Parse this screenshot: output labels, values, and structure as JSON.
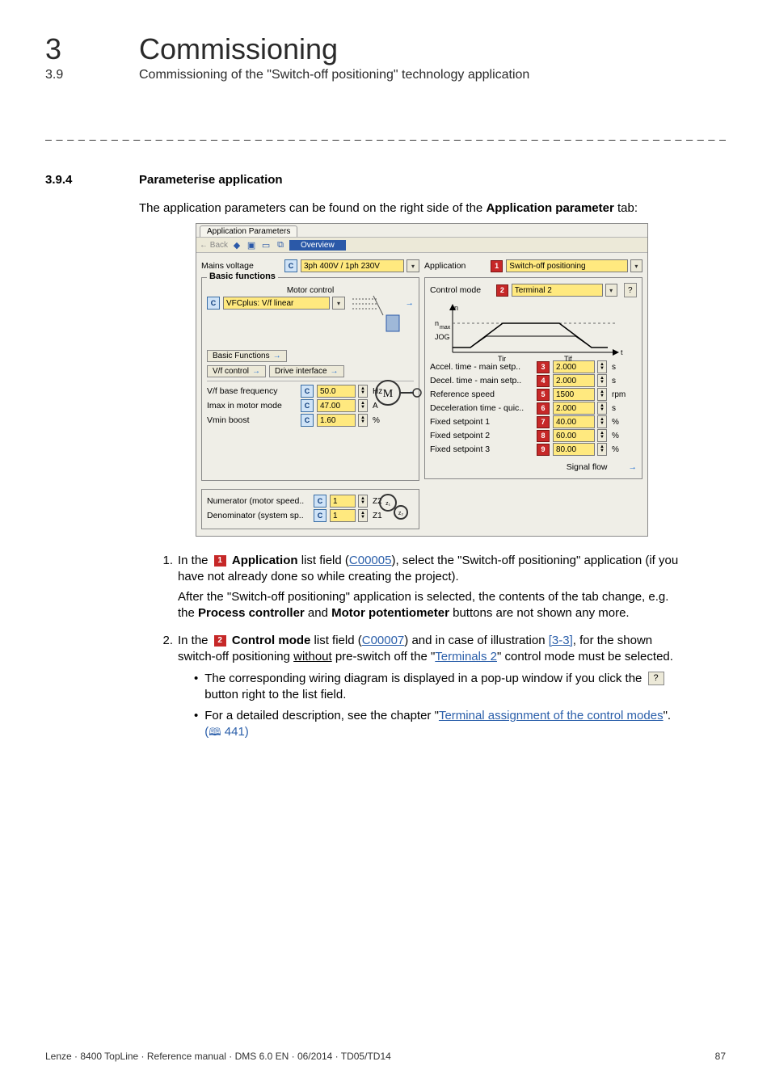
{
  "header": {
    "chapter_number": "3",
    "chapter_title": "Commissioning",
    "section_number": "3.9",
    "section_title": "Commissioning of the \"Switch-off positioning\" technology application"
  },
  "rule": "_ _ _ _ _ _ _ _ _ _ _ _ _ _ _ _ _ _ _ _ _ _ _ _ _ _ _ _ _ _ _ _ _ _ _ _ _ _ _ _ _ _ _ _ _ _ _ _ _ _ _ _ _ _ _ _ _ _ _ _ _ _ _ _",
  "subsection": {
    "number": "3.9.4",
    "title": "Parameterise application"
  },
  "intro": {
    "pre": "The application parameters can be found on the right side of the ",
    "bold": "Application parameter",
    "post": " tab:"
  },
  "shot": {
    "tab_label": "Application Parameters",
    "toolbar": {
      "back": "← Back",
      "overview": "Overview"
    },
    "left": {
      "mains_voltage_label": "Mains voltage",
      "mains_voltage_value": "3ph 400V / 1ph 230V",
      "basic_functions_title": "Basic functions",
      "motor_control_label": "Motor control",
      "motor_control_value": "VFCplus: V/f linear",
      "basic_functions_btn": "Basic Functions",
      "vf_control_btn": "V/f control",
      "drive_interface_btn": "Drive interface",
      "vf_base_freq_label": "V/f base frequency",
      "vf_base_freq_value": "50.0",
      "vf_base_freq_unit": "Hz",
      "imax_label": "Imax in motor mode",
      "imax_value": "47.00",
      "imax_unit": "A",
      "vmin_label": "Vmin boost",
      "vmin_value": "1.60",
      "vmin_unit": "%",
      "numerator_label": "Numerator (motor speed..",
      "numerator_value": "1",
      "numerator_unit": "Z2",
      "denominator_label": "Denominator (system sp..",
      "denominator_value": "1",
      "denominator_unit": "Z1"
    },
    "right": {
      "application_label": "Application",
      "application_value": "Switch-off positioning",
      "control_mode_label": "Control mode",
      "control_mode_value": "Terminal 2",
      "graph": {
        "n": "n",
        "nmax": "n",
        "nmax_sub": "max",
        "jog": "JOG",
        "tir": "Tir",
        "tif": "Tif",
        "t": "t"
      },
      "params": [
        {
          "marker": "3",
          "label": "Accel. time - main setp..",
          "value": "2.000",
          "unit": "s"
        },
        {
          "marker": "4",
          "label": "Decel. time - main setp..",
          "value": "2.000",
          "unit": "s"
        },
        {
          "marker": "5",
          "label": "Reference speed",
          "value": "1500",
          "unit": "rpm"
        },
        {
          "marker": "6",
          "label": "Deceleration time - quic..",
          "value": "2.000",
          "unit": "s"
        },
        {
          "marker": "7",
          "label": "Fixed setpoint 1",
          "value": "40.00",
          "unit": "%"
        },
        {
          "marker": "8",
          "label": "Fixed setpoint 2",
          "value": "60.00",
          "unit": "%"
        },
        {
          "marker": "9",
          "label": "Fixed setpoint 3",
          "value": "80.00",
          "unit": "%"
        }
      ],
      "signal_flow": "Signal flow"
    },
    "markers": {
      "m1": "1",
      "m2": "2"
    }
  },
  "step1": {
    "num": "1.",
    "t1": "In the ",
    "bold1": "Application",
    "t2": " list field (",
    "link1": "C00005",
    "t3": "), select the \"Switch-off positioning\" application (if you have not already done so while creating the project).",
    "cont1": "After the \"Switch-off positioning\" application is selected, the contents of the tab change, e.g. the ",
    "bold2": "Process controller",
    "mid": " and ",
    "bold3": "Motor potentiometer",
    "cont2": " buttons are not shown any more."
  },
  "step2": {
    "num": "2.",
    "t1": "In the ",
    "bold1": "Control mode",
    "t2": " list field (",
    "link1": "C00007",
    "t3": ") and in case of illustration ",
    "link2": "[3-3]",
    "t4": ", for the shown switch-off positioning ",
    "under1": "without",
    "t5": " pre-switch off the \"",
    "link3": "Terminals 2",
    "t6": "\" control mode must be selected.",
    "b1a": "The corresponding wiring diagram is displayed in a pop-up window if you click the ",
    "b1b": " button right to the list field.",
    "b2a": "For a detailed description, see the chapter \"",
    "b2link": "Terminal assignment of the control modes",
    "b2b": "\".",
    "pageref": " 441)"
  },
  "footer": {
    "left": "Lenze · 8400 TopLine · Reference manual · DMS 6.0 EN · 06/2014 · TD05/TD14",
    "right": "87"
  },
  "glyphs": {
    "caret": "▾",
    "arrow_right": "→",
    "up": "▲",
    "down": "▼",
    "q": "?",
    "bullet": "•",
    "book": "🕮",
    "paren_open": "("
  }
}
